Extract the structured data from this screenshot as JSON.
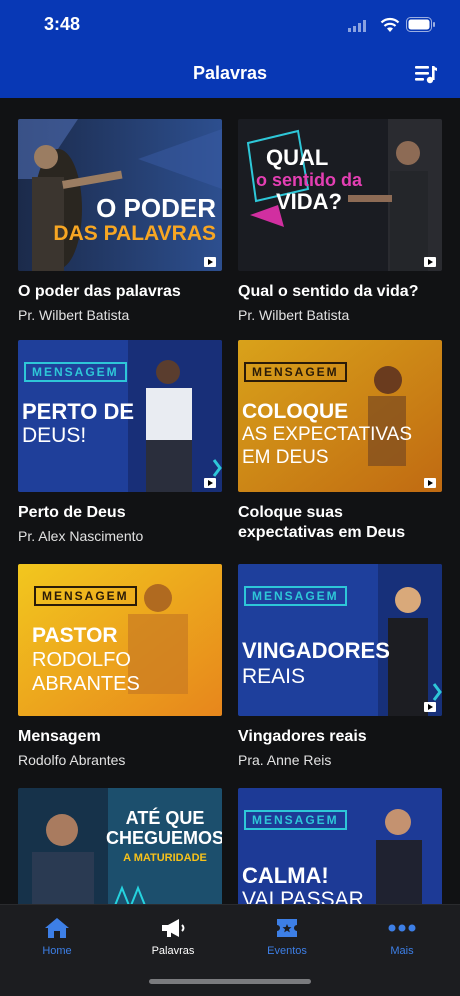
{
  "status": {
    "time": "3:48"
  },
  "header": {
    "title": "Palavras"
  },
  "cards": [
    {
      "title": "O poder das palavras",
      "author": "Pr. Wilbert Batista",
      "thumb_text": [
        "O PODER",
        "DAS PALAVRAS"
      ]
    },
    {
      "title": "Qual o sentido da vida?",
      "author": "Pr. Wilbert Batista",
      "thumb_text": [
        "QUAL",
        "o sentido da",
        "VIDA?"
      ]
    },
    {
      "title": "Perto de Deus",
      "author": "Pr. Alex Nascimento",
      "thumb_text": [
        "MENSAGEM",
        "PERTO DE",
        "DEUS!"
      ]
    },
    {
      "title": "Coloque suas expectativas em Deus",
      "author": "",
      "thumb_text": [
        "MENSAGEM",
        "COLOQUE",
        "AS EXPECTATIVAS",
        "EM DEUS"
      ]
    },
    {
      "title": "Mensagem",
      "author": "Rodolfo Abrantes",
      "thumb_text": [
        "MENSAGEM",
        "PASTOR",
        "RODOLFO",
        "ABRANTES"
      ]
    },
    {
      "title": "Vingadores reais",
      "author": "Pra. Anne Reis",
      "thumb_text": [
        "MENSAGEM",
        "VINGADORES",
        "REAIS"
      ]
    },
    {
      "title": "",
      "author": "",
      "thumb_text": [
        "ATÉ QUE",
        "CHEGUEMOS",
        "A MATURIDADE"
      ]
    },
    {
      "title": "",
      "author": "",
      "thumb_text": [
        "MENSAGEM",
        "CALMA!",
        "VAI PASSAR"
      ]
    }
  ],
  "tabs": [
    {
      "label": "Home",
      "icon": "home-icon",
      "active": true
    },
    {
      "label": "Palavras",
      "icon": "megaphone-icon",
      "active": false
    },
    {
      "label": "Eventos",
      "icon": "ticket-icon",
      "active": true
    },
    {
      "label": "Mais",
      "icon": "more-icon",
      "active": true
    }
  ],
  "colors": {
    "header": "#0838b5",
    "tab_active": "#3d7fe6",
    "tab_inactive": "#ffffff",
    "background": "#111214"
  }
}
